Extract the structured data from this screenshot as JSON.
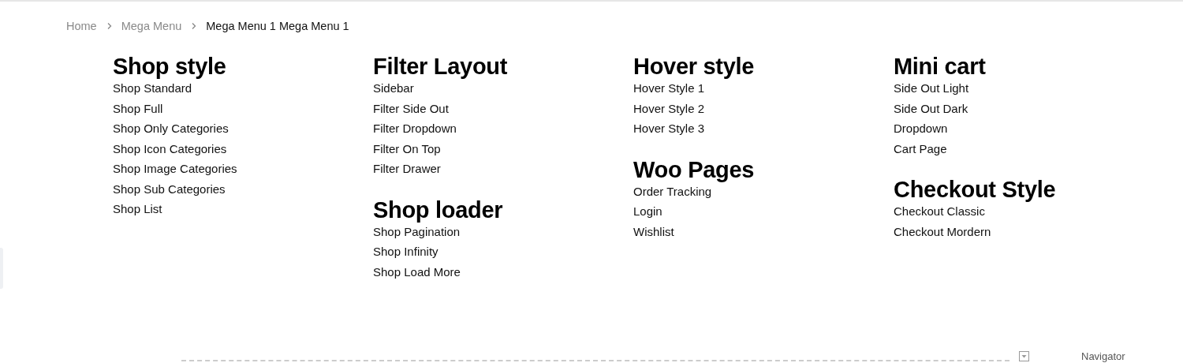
{
  "breadcrumb": [
    {
      "label": "Home",
      "current": false
    },
    {
      "label": "Mega Menu",
      "current": false
    },
    {
      "label": "Mega Menu 1 Mega Menu 1",
      "current": true
    }
  ],
  "columns": [
    {
      "groups": [
        {
          "title": "Shop style",
          "links": [
            "Shop Standard",
            "Shop Full",
            "Shop Only Categories",
            "Shop Icon Categories",
            "Shop Image Categories",
            "Shop Sub Categories",
            "Shop List"
          ]
        }
      ]
    },
    {
      "groups": [
        {
          "title": "Filter Layout",
          "links": [
            "Sidebar",
            "Filter Side Out",
            "Filter Dropdown",
            "Filter On Top",
            "Filter Drawer"
          ]
        },
        {
          "title": "Shop loader",
          "links": [
            "Shop Pagination",
            "Shop Infinity",
            "Shop Load More"
          ]
        }
      ]
    },
    {
      "groups": [
        {
          "title": "Hover style",
          "links": [
            "Hover Style 1",
            "Hover Style 2",
            "Hover Style 3"
          ]
        },
        {
          "title": "Woo Pages",
          "links": [
            "Order Tracking",
            "Login",
            "Wishlist"
          ]
        }
      ]
    },
    {
      "groups": [
        {
          "title": "Mini cart",
          "links": [
            "Side Out Light",
            "Side Out Dark",
            "Dropdown",
            "Cart Page"
          ]
        },
        {
          "title": "Checkout Style",
          "links": [
            "Checkout Classic",
            "Checkout Mordern"
          ]
        }
      ]
    }
  ],
  "navigator": {
    "title": "Navigator"
  }
}
